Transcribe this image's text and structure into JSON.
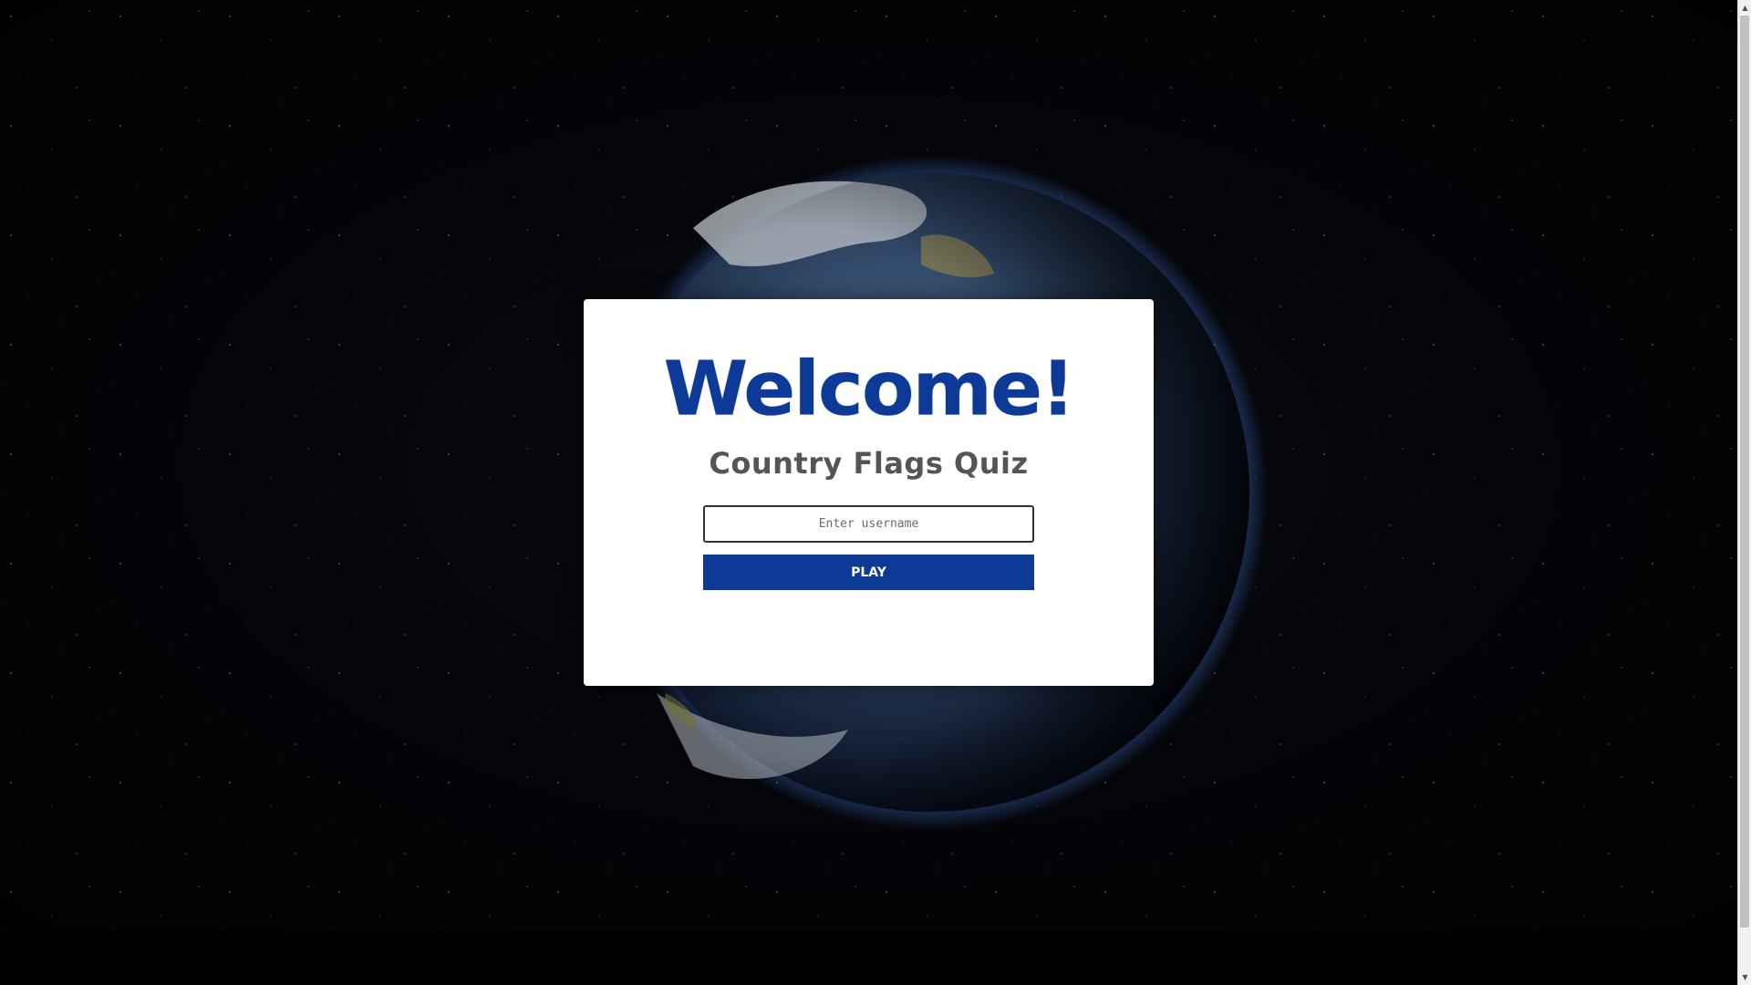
{
  "welcome": {
    "title": "Welcome!",
    "subtitle": "Country Flags Quiz"
  },
  "form": {
    "username_placeholder": "Enter username",
    "username_value": "",
    "play_label": "PLAY"
  },
  "colors": {
    "brand_blue": "#0d3a96",
    "subtitle_gray": "#555555",
    "modal_bg": "#ffffff"
  },
  "background": {
    "icon": "earth-in-space-image"
  }
}
